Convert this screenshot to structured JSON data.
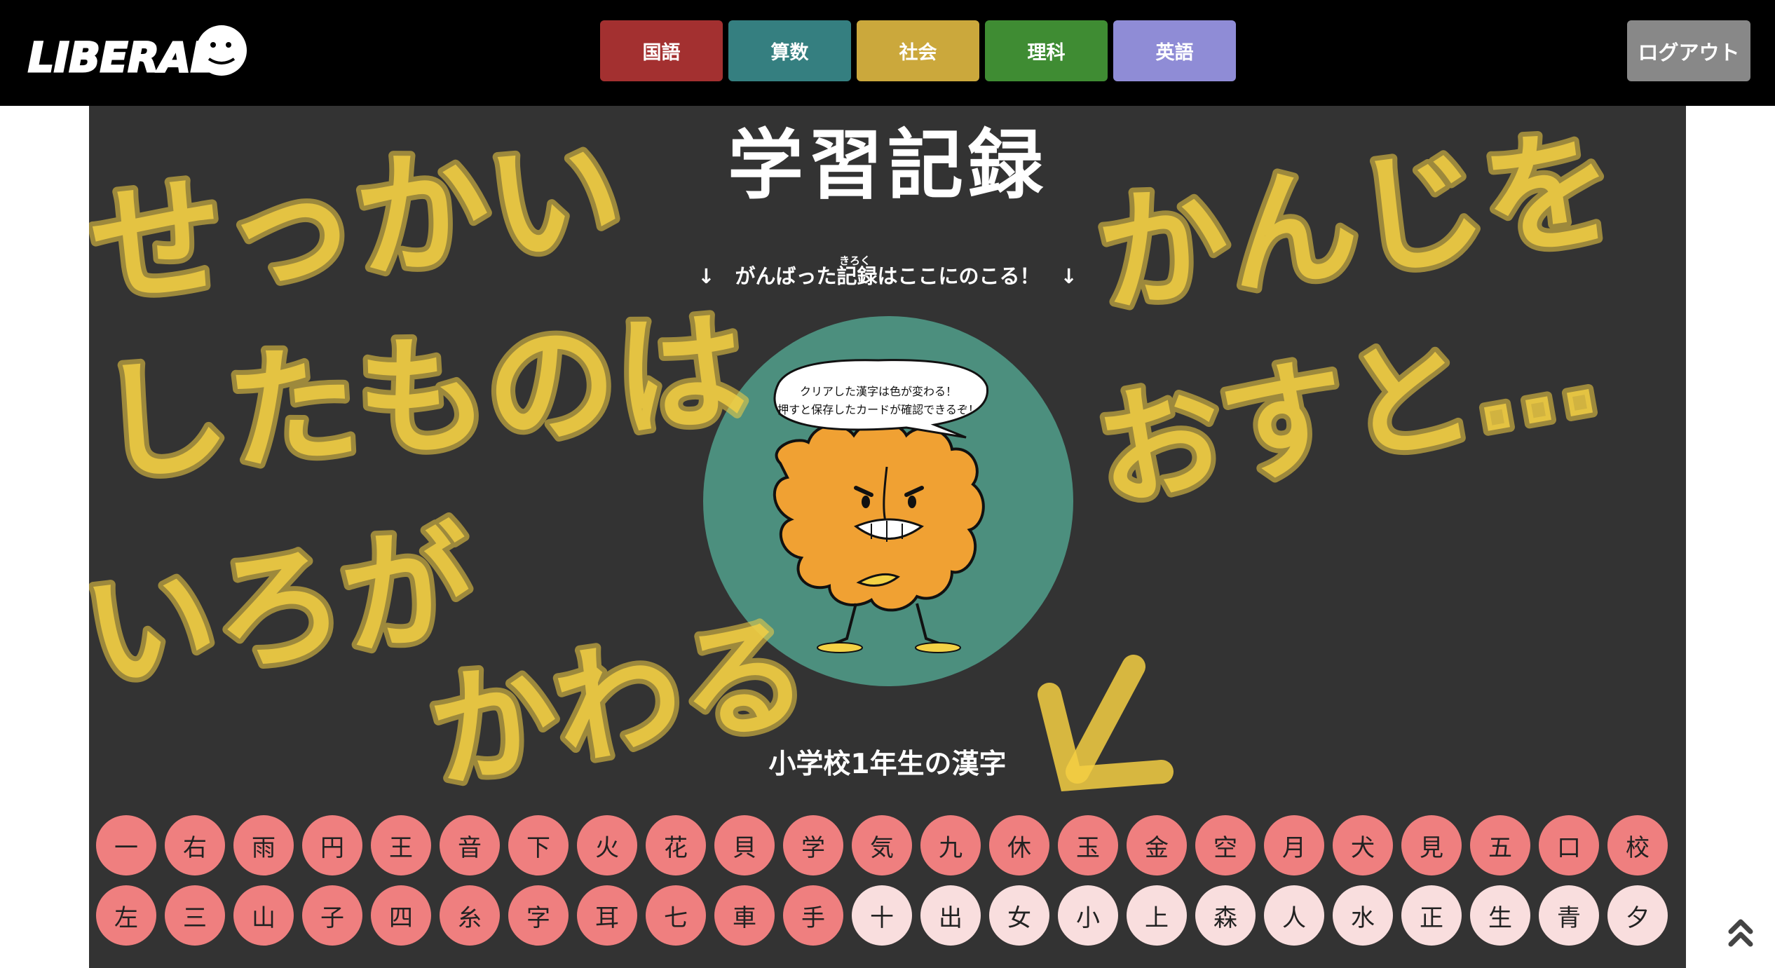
{
  "header": {
    "logo_text": "LIBERAL",
    "subjects": [
      {
        "label": "国語",
        "color": "#a33030"
      },
      {
        "label": "算数",
        "color": "#357f80"
      },
      {
        "label": "社会",
        "color": "#cba83c"
      },
      {
        "label": "理科",
        "color": "#3f8c33"
      },
      {
        "label": "英語",
        "color": "#8f8cd6"
      }
    ],
    "logout_label": "ログアウト"
  },
  "main": {
    "title": "学習記録",
    "subtitle": "↓　がんばった記録はここにのこる！　↓",
    "subtitle_ruby": "きろく",
    "speech_line1": "クリアした漢字は色が変わる！",
    "speech_line2": "押すと保存したカードが確認できるぞ！",
    "overlay_text": [
      "せっかい",
      "したものは",
      "いろが",
      "かわる",
      "かんじを",
      "おすと…"
    ],
    "section_title": "小学校1年生の漢字",
    "colors": {
      "cleared": "#ef7f7f",
      "pending": "#f9dede",
      "panel": "#333333",
      "mascot_bg": "#4c8f7e",
      "scribble": "#f4cf43"
    }
  },
  "kanji": [
    {
      "char": "一",
      "cleared": true
    },
    {
      "char": "右",
      "cleared": true
    },
    {
      "char": "雨",
      "cleared": true
    },
    {
      "char": "円",
      "cleared": true
    },
    {
      "char": "王",
      "cleared": true
    },
    {
      "char": "音",
      "cleared": true
    },
    {
      "char": "下",
      "cleared": true
    },
    {
      "char": "火",
      "cleared": true
    },
    {
      "char": "花",
      "cleared": true
    },
    {
      "char": "貝",
      "cleared": true
    },
    {
      "char": "学",
      "cleared": true
    },
    {
      "char": "気",
      "cleared": true
    },
    {
      "char": "九",
      "cleared": true
    },
    {
      "char": "休",
      "cleared": true
    },
    {
      "char": "玉",
      "cleared": true
    },
    {
      "char": "金",
      "cleared": true
    },
    {
      "char": "空",
      "cleared": true
    },
    {
      "char": "月",
      "cleared": true
    },
    {
      "char": "犬",
      "cleared": true
    },
    {
      "char": "見",
      "cleared": true
    },
    {
      "char": "五",
      "cleared": true
    },
    {
      "char": "口",
      "cleared": true
    },
    {
      "char": "校",
      "cleared": true
    },
    {
      "char": "左",
      "cleared": true
    },
    {
      "char": "三",
      "cleared": true
    },
    {
      "char": "山",
      "cleared": true
    },
    {
      "char": "子",
      "cleared": true
    },
    {
      "char": "四",
      "cleared": true
    },
    {
      "char": "糸",
      "cleared": true
    },
    {
      "char": "字",
      "cleared": true
    },
    {
      "char": "耳",
      "cleared": true
    },
    {
      "char": "七",
      "cleared": true
    },
    {
      "char": "車",
      "cleared": true
    },
    {
      "char": "手",
      "cleared": true
    },
    {
      "char": "十",
      "cleared": false
    },
    {
      "char": "出",
      "cleared": false
    },
    {
      "char": "女",
      "cleared": false
    },
    {
      "char": "小",
      "cleared": false
    },
    {
      "char": "上",
      "cleared": false
    },
    {
      "char": "森",
      "cleared": false
    },
    {
      "char": "人",
      "cleared": false
    },
    {
      "char": "水",
      "cleared": false
    },
    {
      "char": "正",
      "cleared": false
    },
    {
      "char": "生",
      "cleared": false
    },
    {
      "char": "青",
      "cleared": false
    },
    {
      "char": "夕",
      "cleared": false
    }
  ]
}
